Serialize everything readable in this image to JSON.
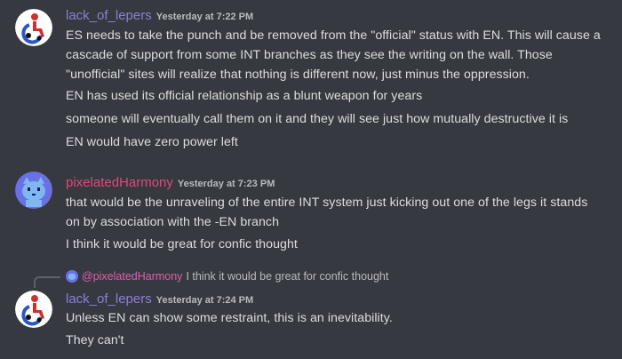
{
  "colors": {
    "background": "#36393f",
    "user1_name": "#8b7fd6",
    "user2_name": "#e0487e",
    "text": "#dcddde",
    "timestamp": "#b9bbbe"
  },
  "messages": [
    {
      "username": "lack_of_lepers",
      "timestamp": "Yesterday at 7:22 PM",
      "avatar_icon": "wheelchair-logo-icon",
      "lines": [
        "ES needs to take the punch and be removed from the \"official\" status with EN. This will cause a",
        "cascade of support from some INT branches as they see the writing on the wall. Those",
        "\"unofficial\" sites will realize that nothing is different now, just minus the oppression.",
        "EN has used its official relationship as a blunt weapon for years",
        "someone will eventually call them on it and they will see just how mutually destructive it is",
        "EN would have zero power left"
      ]
    },
    {
      "username": "pixelatedHarmony",
      "timestamp": "Yesterday at 7:23 PM",
      "avatar_icon": "cat-avatar-icon",
      "lines": [
        "that would be the unraveling of the entire INT system just kicking out one of the legs it stands",
        "on by association with the -EN branch",
        "I think it would be great for confic thought"
      ]
    },
    {
      "reply": {
        "username": "@pixelatedHarmony",
        "text": "I think it would be great for confic thought"
      },
      "username": "lack_of_lepers",
      "timestamp": "Yesterday at 7:24 PM",
      "avatar_icon": "wheelchair-logo-icon",
      "lines": [
        "Unless EN can show some restraint, this is an inevitability.",
        "They can't"
      ]
    }
  ]
}
